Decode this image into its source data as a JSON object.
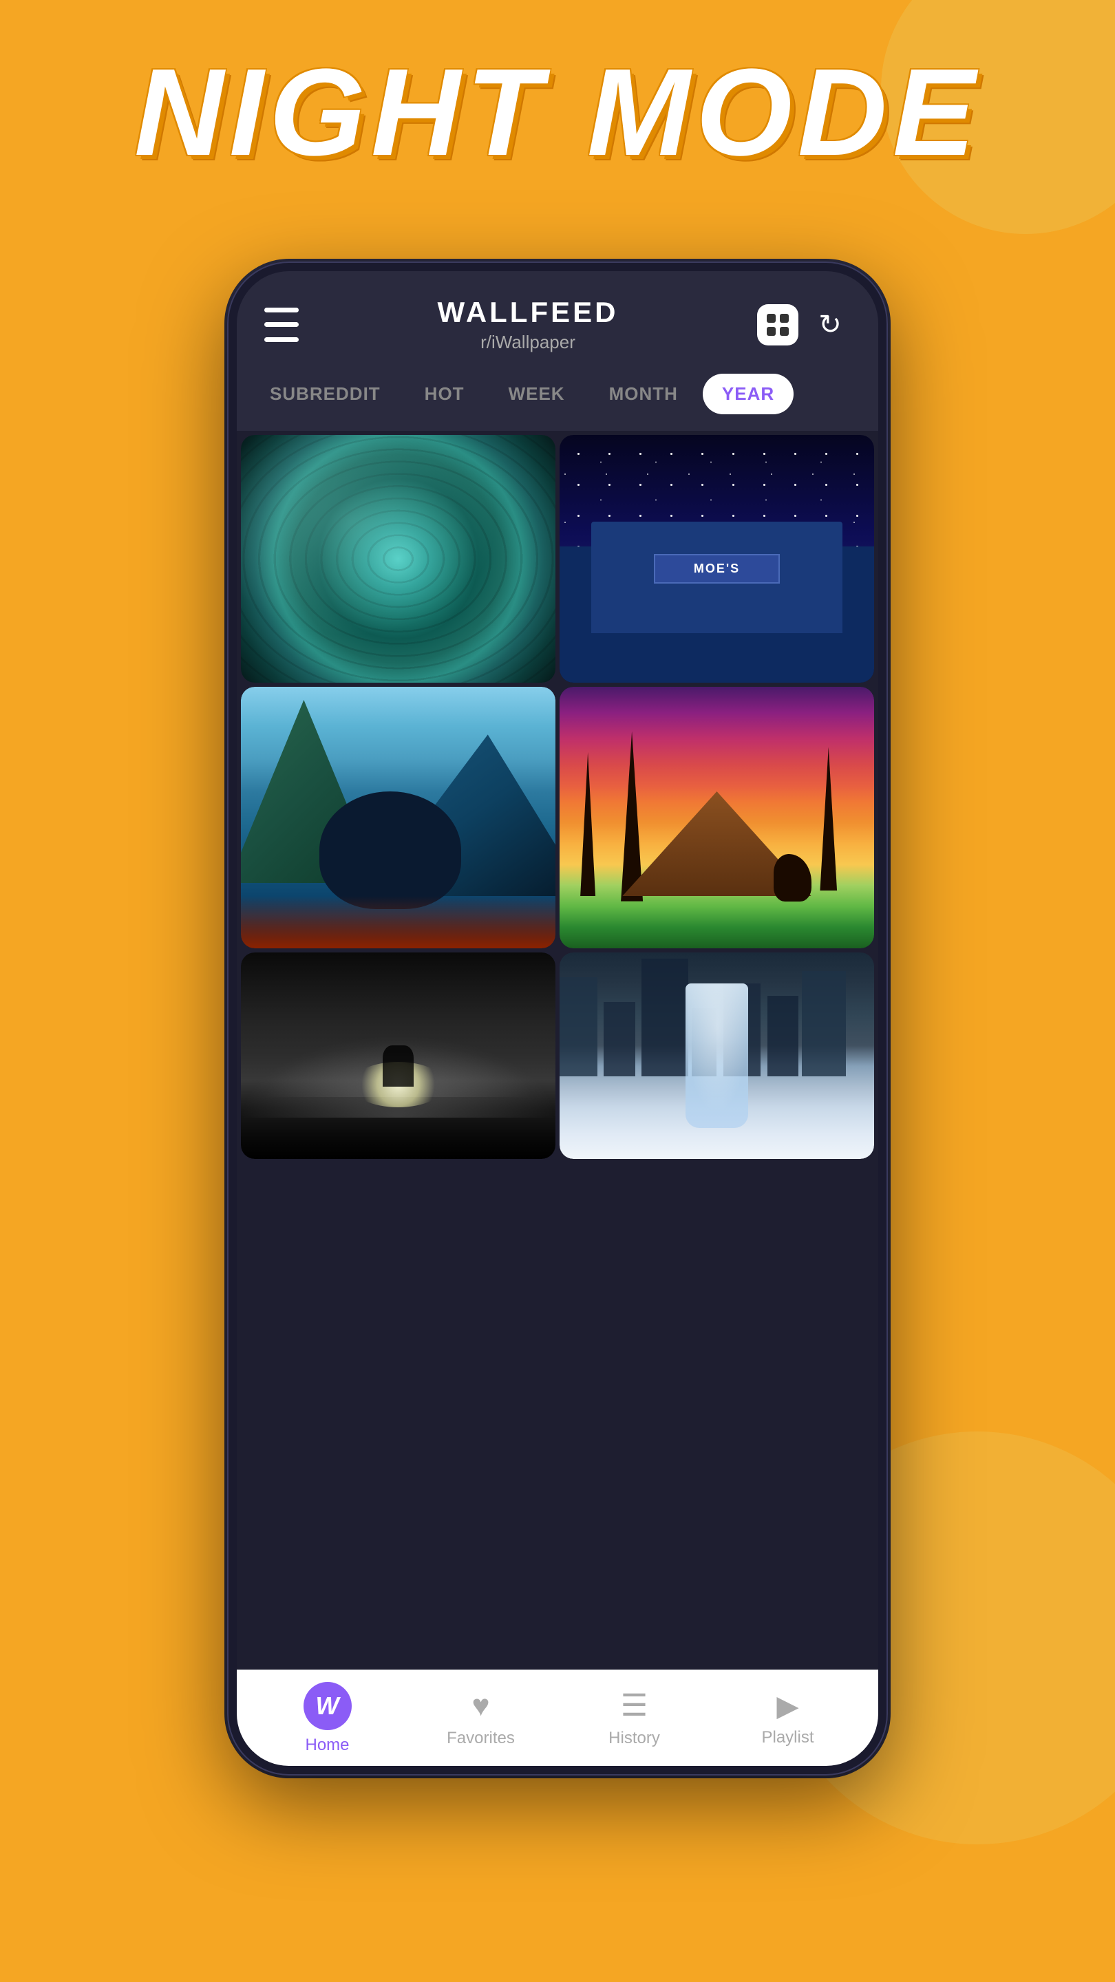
{
  "page": {
    "title": "NIGHT MODE",
    "background_color": "#F5A623"
  },
  "app": {
    "name": "WALLFEED",
    "subreddit": "r/iWallpaper",
    "filter_tabs": [
      {
        "id": "subreddit",
        "label": "SUBREDDIT",
        "active": false
      },
      {
        "id": "hot",
        "label": "HOT",
        "active": false
      },
      {
        "id": "week",
        "label": "WEEK",
        "active": false
      },
      {
        "id": "month",
        "label": "MONTH",
        "active": false
      },
      {
        "id": "year",
        "label": "YEAR",
        "active": true
      }
    ],
    "wallpapers": [
      {
        "id": 1,
        "description": "Circular planet texture",
        "position": "top-left"
      },
      {
        "id": 2,
        "description": "Night city scene Moe's bar",
        "position": "top-right"
      },
      {
        "id": 3,
        "description": "Fantasy landscape with bear",
        "position": "mid-left"
      },
      {
        "id": 4,
        "description": "Sunset mountains with fox",
        "position": "mid-right"
      },
      {
        "id": 5,
        "description": "Dark misty moon scene",
        "position": "bottom-left"
      },
      {
        "id": 6,
        "description": "City with ice formation",
        "position": "bottom-right"
      }
    ],
    "bottom_nav": [
      {
        "id": "home",
        "label": "Home",
        "icon": "W",
        "active": true
      },
      {
        "id": "favorites",
        "label": "Favorites",
        "icon": "♥",
        "active": false
      },
      {
        "id": "history",
        "label": "History",
        "icon": "☰",
        "active": false
      },
      {
        "id": "playlist",
        "label": "Playlist",
        "icon": "▶",
        "active": false
      }
    ]
  }
}
